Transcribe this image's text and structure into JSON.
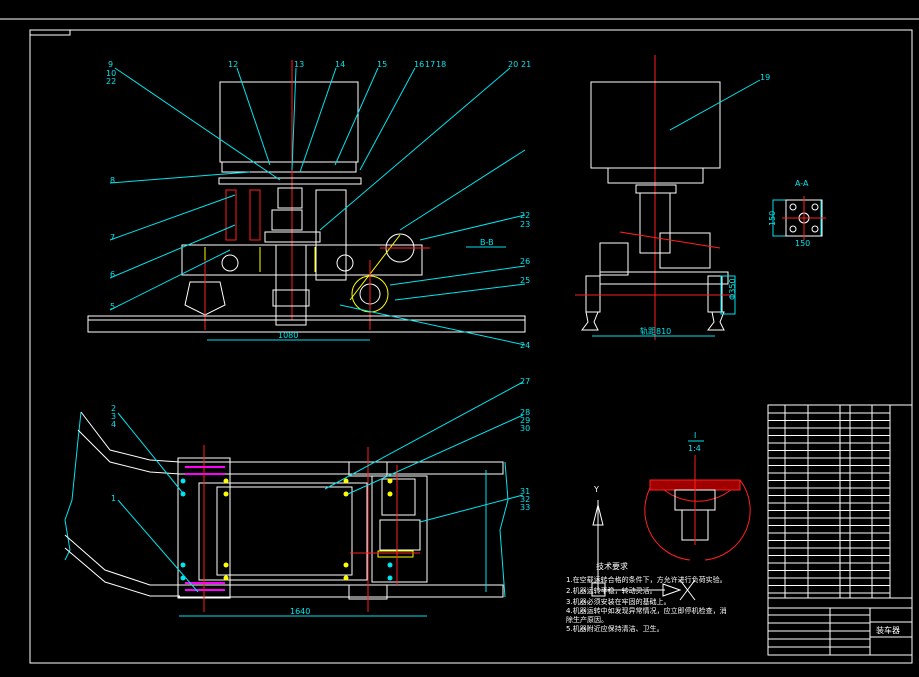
{
  "drawing": {
    "background": "#000000",
    "colors": {
      "outline": "#ffffff",
      "dimension": "#00e5ee",
      "centerline": "#ff2020",
      "hidden": "#ffff00",
      "highlight": "#ff00ff"
    },
    "front_view": {
      "balloons": [
        "9",
        "10",
        "22",
        "12",
        "13",
        "14",
        "15",
        "16",
        "17",
        "18",
        "20",
        "21",
        "8",
        "7",
        "6",
        "5",
        "22",
        "23",
        "26",
        "25",
        "24"
      ],
      "dimension": "1080",
      "section_mark": "B-B"
    },
    "side_view": {
      "balloon": "19",
      "dimension_width": "轨距810",
      "dimension_height": "Φ350"
    },
    "section_view": {
      "title": "A-A",
      "dimension_a": "150",
      "dimension_b": "150"
    },
    "detail_view": {
      "label": "I",
      "scale": "1:4"
    },
    "top_view": {
      "balloons": [
        "2",
        "3",
        "4",
        "1",
        "27",
        "28",
        "29",
        "30",
        "31",
        "32",
        "33"
      ],
      "dimension": "1640"
    },
    "axis_symbol": {
      "label": "Y"
    },
    "technical_requirements": {
      "title": "技术要求",
      "items": [
        "1.在空载运转合格的条件下，方允许进行负荷实验。",
        "2.机器运转平稳，转动灵活。",
        "3.机器必须安装在牢固的基础上。",
        "4.机器运转中如发现异常情况，应立即停机检查，消",
        "除生产原因。",
        "5.机器附近应保持清洁、卫生。"
      ]
    },
    "title_block": {
      "drawing_name": "装车器"
    }
  }
}
